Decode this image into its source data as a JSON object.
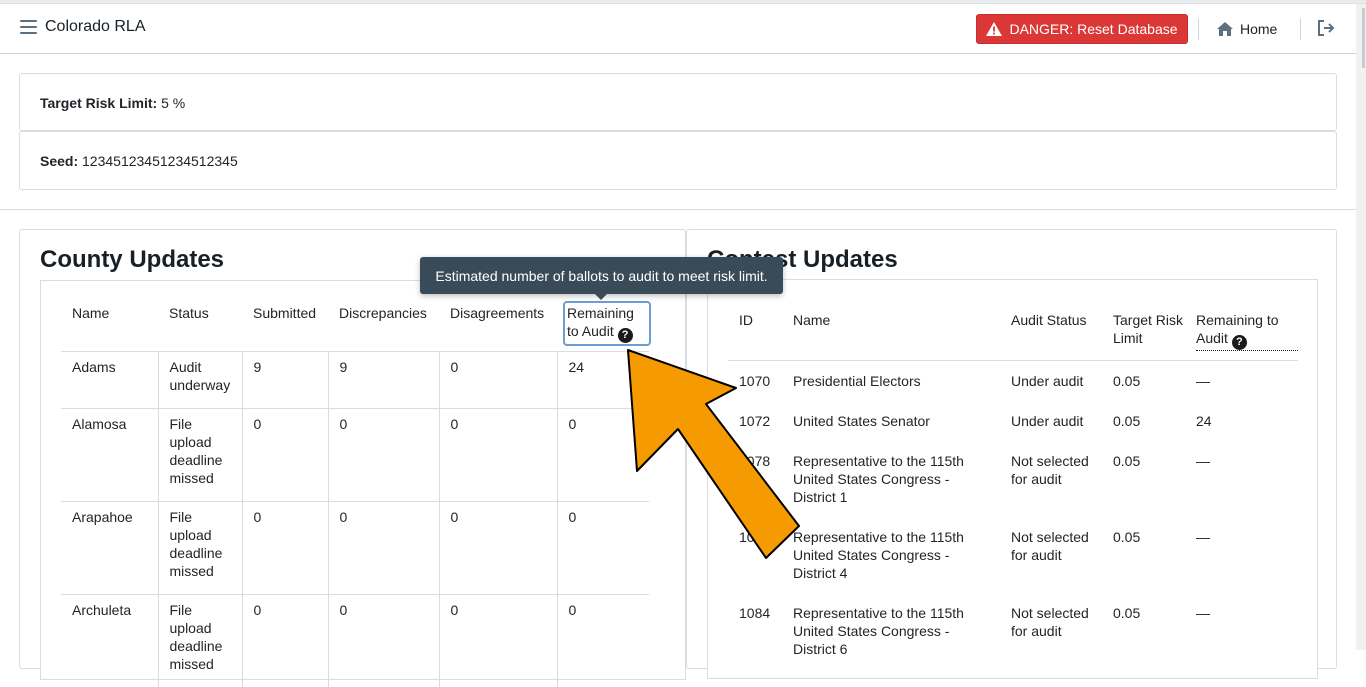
{
  "navbar": {
    "brand": "Colorado RLA",
    "danger_button": "DANGER: Reset Database",
    "home": "Home",
    "icons": [
      "menu-icon",
      "warning-icon",
      "home-icon",
      "logout-icon"
    ]
  },
  "summary": {
    "risk_label": "Target Risk Limit:",
    "risk_value": "5 %",
    "seed_label": "Seed:",
    "seed_value": "12345123451234512345"
  },
  "county": {
    "title": "County Updates",
    "headers": [
      "Name",
      "Status",
      "Submitted",
      "Discrepancies",
      "Disagreements",
      "Remaining to Audit"
    ],
    "rows": [
      {
        "name": "Adams",
        "status": "Audit underway",
        "submitted": "9",
        "discrepancies": "9",
        "disagreements": "0",
        "remaining": "24"
      },
      {
        "name": "Alamosa",
        "status": "File upload deadline missed",
        "submitted": "0",
        "discrepancies": "0",
        "disagreements": "0",
        "remaining": "0"
      },
      {
        "name": "Arapahoe",
        "status": "File upload deadline missed",
        "submitted": "0",
        "discrepancies": "0",
        "disagreements": "0",
        "remaining": "0"
      },
      {
        "name": "Archuleta",
        "status": "File upload deadline missed",
        "submitted": "0",
        "discrepancies": "0",
        "disagreements": "0",
        "remaining": "0"
      }
    ]
  },
  "tooltip": {
    "text": "Estimated number of ballots to audit to meet risk limit."
  },
  "contest": {
    "title": "Contest Updates",
    "headers": [
      "ID",
      "Name",
      "Audit Status",
      "Target Risk Limit",
      "Remaining to Audit"
    ],
    "rows": [
      {
        "id": "1070",
        "name": "Presidential Electors",
        "status": "Under audit",
        "risk": "0.05",
        "remaining": "—"
      },
      {
        "id": "1072",
        "name": "United States Senator",
        "status": "Under audit",
        "risk": "0.05",
        "remaining": "24"
      },
      {
        "id": "1078",
        "name": "Representative to the 115th United States Congress - District 1",
        "status": "Not selected for audit",
        "risk": "0.05",
        "remaining": "—"
      },
      {
        "id": "1082",
        "name": "Representative to the 115th United States Congress - District 4",
        "status": "Not selected for audit",
        "risk": "0.05",
        "remaining": "—"
      },
      {
        "id": "1084",
        "name": "Representative to the 115th United States Congress - District 6",
        "status": "Not selected for audit",
        "risk": "0.05",
        "remaining": "—"
      }
    ]
  },
  "colors": {
    "danger": "#db3737",
    "tooltip_bg": "#394b59",
    "arrow": "#f59a00"
  }
}
